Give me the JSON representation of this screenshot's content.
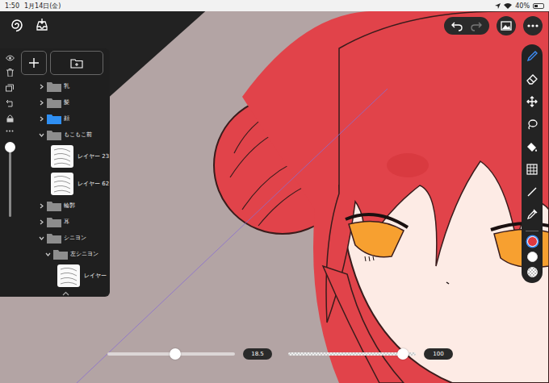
{
  "status_bar": {
    "time": "1:50",
    "date": "1月14日(金)",
    "battery": "40%",
    "battery_level": 0.4
  },
  "layer_panel": {
    "opacity_level": 0.95,
    "layers": [
      {
        "kind": "folder",
        "name": "乳",
        "depth": 0,
        "expanded": false,
        "selected": false
      },
      {
        "kind": "folder",
        "name": "髪",
        "depth": 0,
        "expanded": false,
        "selected": false
      },
      {
        "kind": "folder",
        "name": "顔",
        "depth": 0,
        "expanded": false,
        "selected": true
      },
      {
        "kind": "folder",
        "name": "もこもこ前",
        "depth": 0,
        "expanded": true,
        "selected": false
      },
      {
        "kind": "layer",
        "name": "レイヤー 23",
        "depth": 1,
        "expanded": false,
        "selected": false
      },
      {
        "kind": "layer",
        "name": "レイヤー 62",
        "depth": 1,
        "expanded": false,
        "selected": false
      },
      {
        "kind": "folder",
        "name": "輪郭",
        "depth": 0,
        "expanded": false,
        "selected": false
      },
      {
        "kind": "folder",
        "name": "耳",
        "depth": 0,
        "expanded": false,
        "selected": false
      },
      {
        "kind": "folder",
        "name": "シニヨン",
        "depth": 0,
        "expanded": true,
        "selected": false
      },
      {
        "kind": "folder",
        "name": "左シニヨン",
        "depth": 1,
        "expanded": true,
        "selected": false
      },
      {
        "kind": "layer",
        "name": "レイヤー",
        "depth": 2,
        "expanded": false,
        "selected": false
      }
    ]
  },
  "tools": [
    {
      "kind": "brush",
      "selected": true
    },
    {
      "kind": "eraser",
      "selected": false
    },
    {
      "kind": "move",
      "selected": false
    },
    {
      "kind": "lasso",
      "selected": false
    },
    {
      "kind": "fill",
      "selected": false
    },
    {
      "kind": "grid",
      "selected": false
    },
    {
      "kind": "line",
      "selected": false
    },
    {
      "kind": "eyedropper",
      "selected": false
    }
  ],
  "colors": [
    {
      "kind": "solid",
      "color": "#e0393f",
      "selected": true
    },
    {
      "kind": "solid",
      "color": "#ffffff",
      "selected": false
    },
    {
      "kind": "transparent",
      "color": "#ffffff",
      "selected": false
    }
  ],
  "sliders": [
    {
      "name": "size",
      "level": 0.53,
      "reading": "18.5"
    },
    {
      "name": "opacity",
      "level": 0.9,
      "reading": "100"
    }
  ]
}
